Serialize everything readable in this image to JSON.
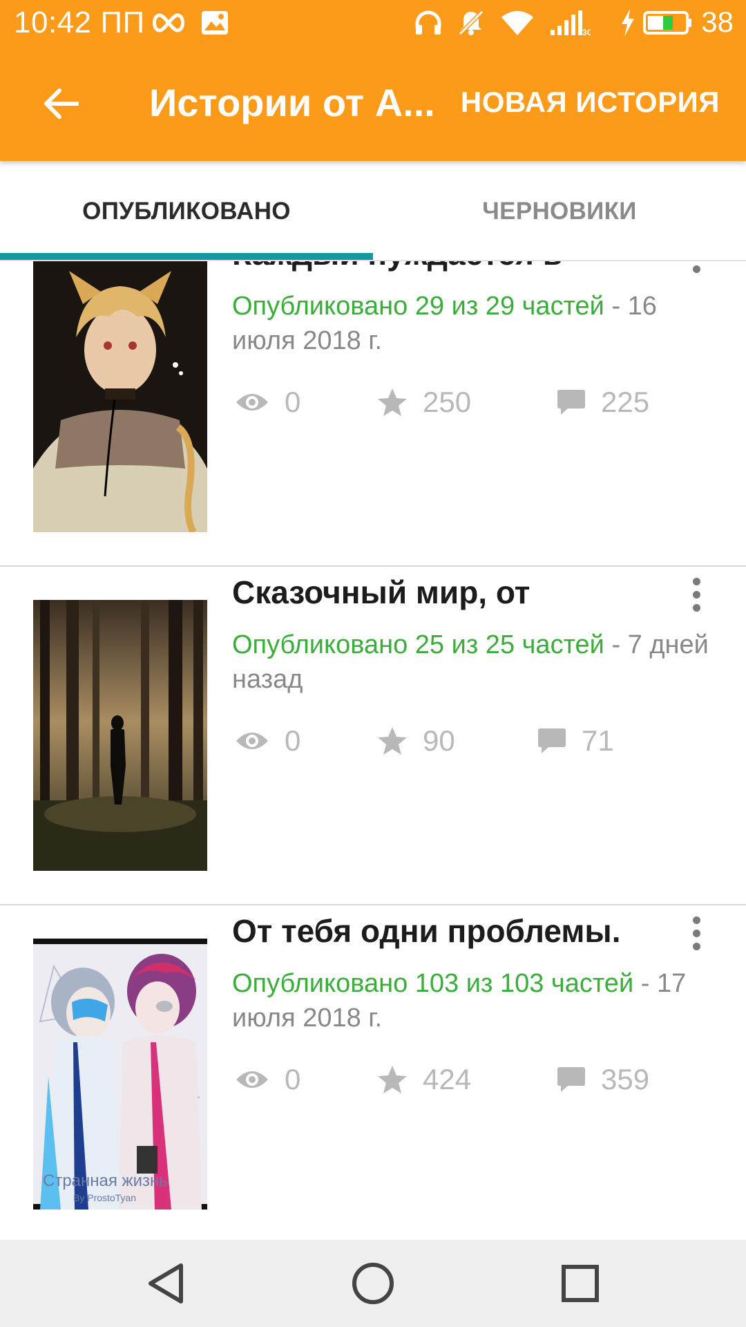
{
  "status_bar": {
    "time": "10:42 ПП",
    "battery_percent": "38",
    "network": "3G",
    "icons": [
      "infinity-icon",
      "gallery-icon",
      "headphones-icon",
      "mute-icon",
      "wifi-icon",
      "signal-icon",
      "charging-icon",
      "battery-icon"
    ]
  },
  "toolbar": {
    "title": "Истории от А...",
    "new_story_label": "НОВАЯ ИСТОРИЯ",
    "color": "#fc9a19"
  },
  "tabs": [
    {
      "label": "ОПУБЛИКОВАНО",
      "active": true
    },
    {
      "label": "ЧЕРНОВИКИ",
      "active": false
    }
  ],
  "accent_colors": {
    "tab_indicator": "#1697a4",
    "published_text": "#3aad3a"
  },
  "stories": [
    {
      "title": "Каждый нуждается в",
      "published": "Опубликовано 29 из 29 частей",
      "date": " - 16 июля 2018 г.",
      "views": "0",
      "votes": "250",
      "comments": "225"
    },
    {
      "title": "Сказочный мир, от",
      "published": "Опубликовано 25 из 25 частей",
      "date": " - 7 дней назад",
      "views": "0",
      "votes": "90",
      "comments": "71"
    },
    {
      "title": "От тебя одни проблемы.",
      "published": "Опубликовано 103 из 103 частей",
      "date": " - 17 июля 2018 г.",
      "views": "0",
      "votes": "424",
      "comments": "359",
      "cover_text": "Странная жизнь",
      "cover_credit": "By ProstoTyan"
    }
  ],
  "nav": [
    "back-nav-icon",
    "home-nav-icon",
    "recents-nav-icon"
  ]
}
